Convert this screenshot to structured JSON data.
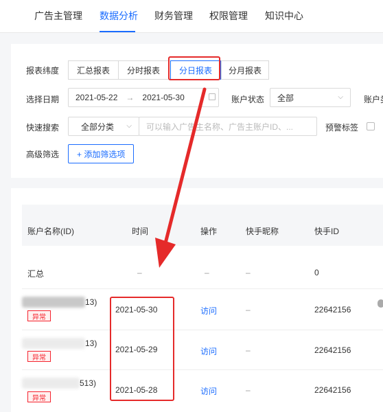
{
  "nav": {
    "items": [
      "广告主管理",
      "数据分析",
      "财务管理",
      "权限管理",
      "知识中心"
    ]
  },
  "filters": {
    "report_dim_label": "报表纬度",
    "report_tabs": [
      "汇总报表",
      "分时报表",
      "分日报表",
      "分月报表"
    ],
    "date_label": "选择日期",
    "date_start": "2021-05-22",
    "date_arrow": "→",
    "date_end": "2021-05-30",
    "status_label": "账户状态",
    "status_value": "全部",
    "extra_label": "账户类",
    "quick_search_label": "快速搜索",
    "category_value": "全部分类",
    "search_placeholder": "可以输入广告主名称、广告主账户ID、...",
    "warn_label": "预警标签",
    "advanced_label": "高级筛选",
    "add_filter_label": "+ 添加筛选项"
  },
  "table": {
    "headers": [
      "账户名称(ID)",
      "时间",
      "操作",
      "快手昵称",
      "快手ID"
    ],
    "summary": {
      "name": "汇总",
      "time": "–",
      "op": "–",
      "nick": "–",
      "kid": "0"
    },
    "rows": [
      {
        "id_suffix": "13)",
        "badge": "异常",
        "time": "2021-05-30",
        "op": "访问",
        "nick": "–",
        "kid": "22642156"
      },
      {
        "id_suffix": "13)",
        "badge": "异常",
        "time": "2021-05-29",
        "op": "访问",
        "nick": "–",
        "kid": "22642156"
      },
      {
        "id_suffix": "513)",
        "badge": "异常",
        "time": "2021-05-28",
        "op": "访问",
        "nick": "–",
        "kid": "22642156"
      }
    ]
  },
  "colors": {
    "accent": "#1a6cff",
    "annotation": "#e52a2a",
    "danger": "#f5222d"
  }
}
